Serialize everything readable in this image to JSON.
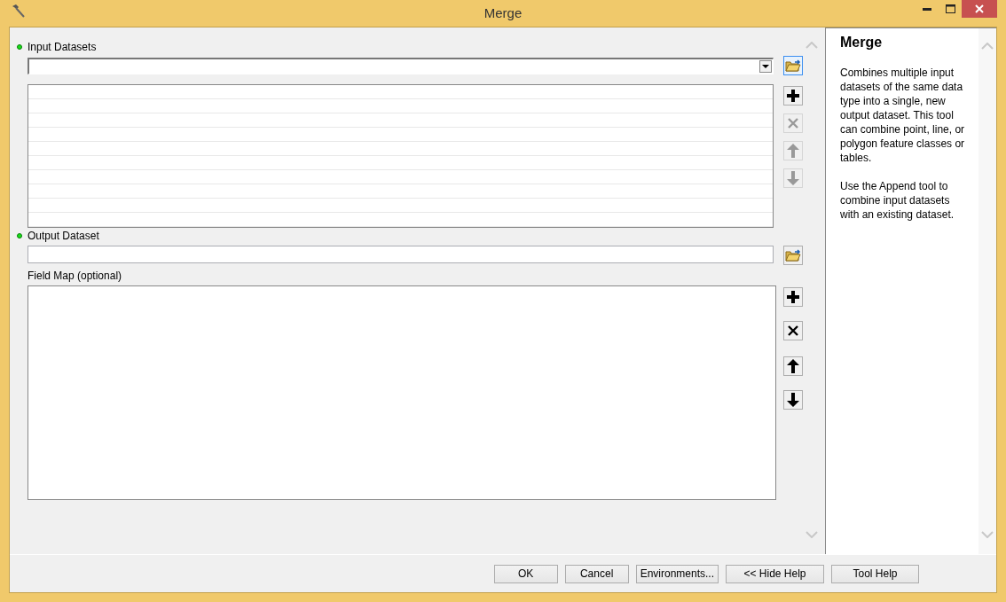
{
  "window": {
    "title": "Merge"
  },
  "parameters": [
    {
      "kind": "multivalue",
      "label": "Input Datasets",
      "required": true,
      "buttons": [
        {
          "kind": "browse",
          "disabled": false,
          "focused": true
        },
        {
          "kind": "add",
          "disabled": false,
          "focused": false
        },
        {
          "kind": "remove",
          "disabled": true,
          "focused": false
        },
        {
          "kind": "up",
          "disabled": true,
          "focused": false
        },
        {
          "kind": "down",
          "disabled": true,
          "focused": false
        }
      ]
    },
    {
      "kind": "dataset",
      "label": "Output Dataset",
      "required": true,
      "buttons": [
        {
          "kind": "browse",
          "disabled": false,
          "focused": false
        }
      ]
    },
    {
      "kind": "fieldmap",
      "label": "Field Map (optional)",
      "required": false,
      "buttons": [
        {
          "kind": "add",
          "disabled": false,
          "focused": false
        },
        {
          "kind": "remove",
          "disabled": false,
          "focused": false
        },
        {
          "kind": "up",
          "disabled": false,
          "focused": false
        },
        {
          "kind": "down",
          "disabled": false,
          "focused": false
        }
      ]
    }
  ],
  "help": {
    "title": "Merge",
    "paragraphs": [
      "Combines multiple input datasets of the same data type into a single, new output dataset. This tool can combine point, line, or polygon feature classes or tables.",
      "Use the Append tool to combine input datasets with an existing dataset."
    ]
  },
  "buttons": [
    "OK",
    "Cancel",
    "Environments...",
    "<< Hide Help",
    "Tool Help"
  ]
}
